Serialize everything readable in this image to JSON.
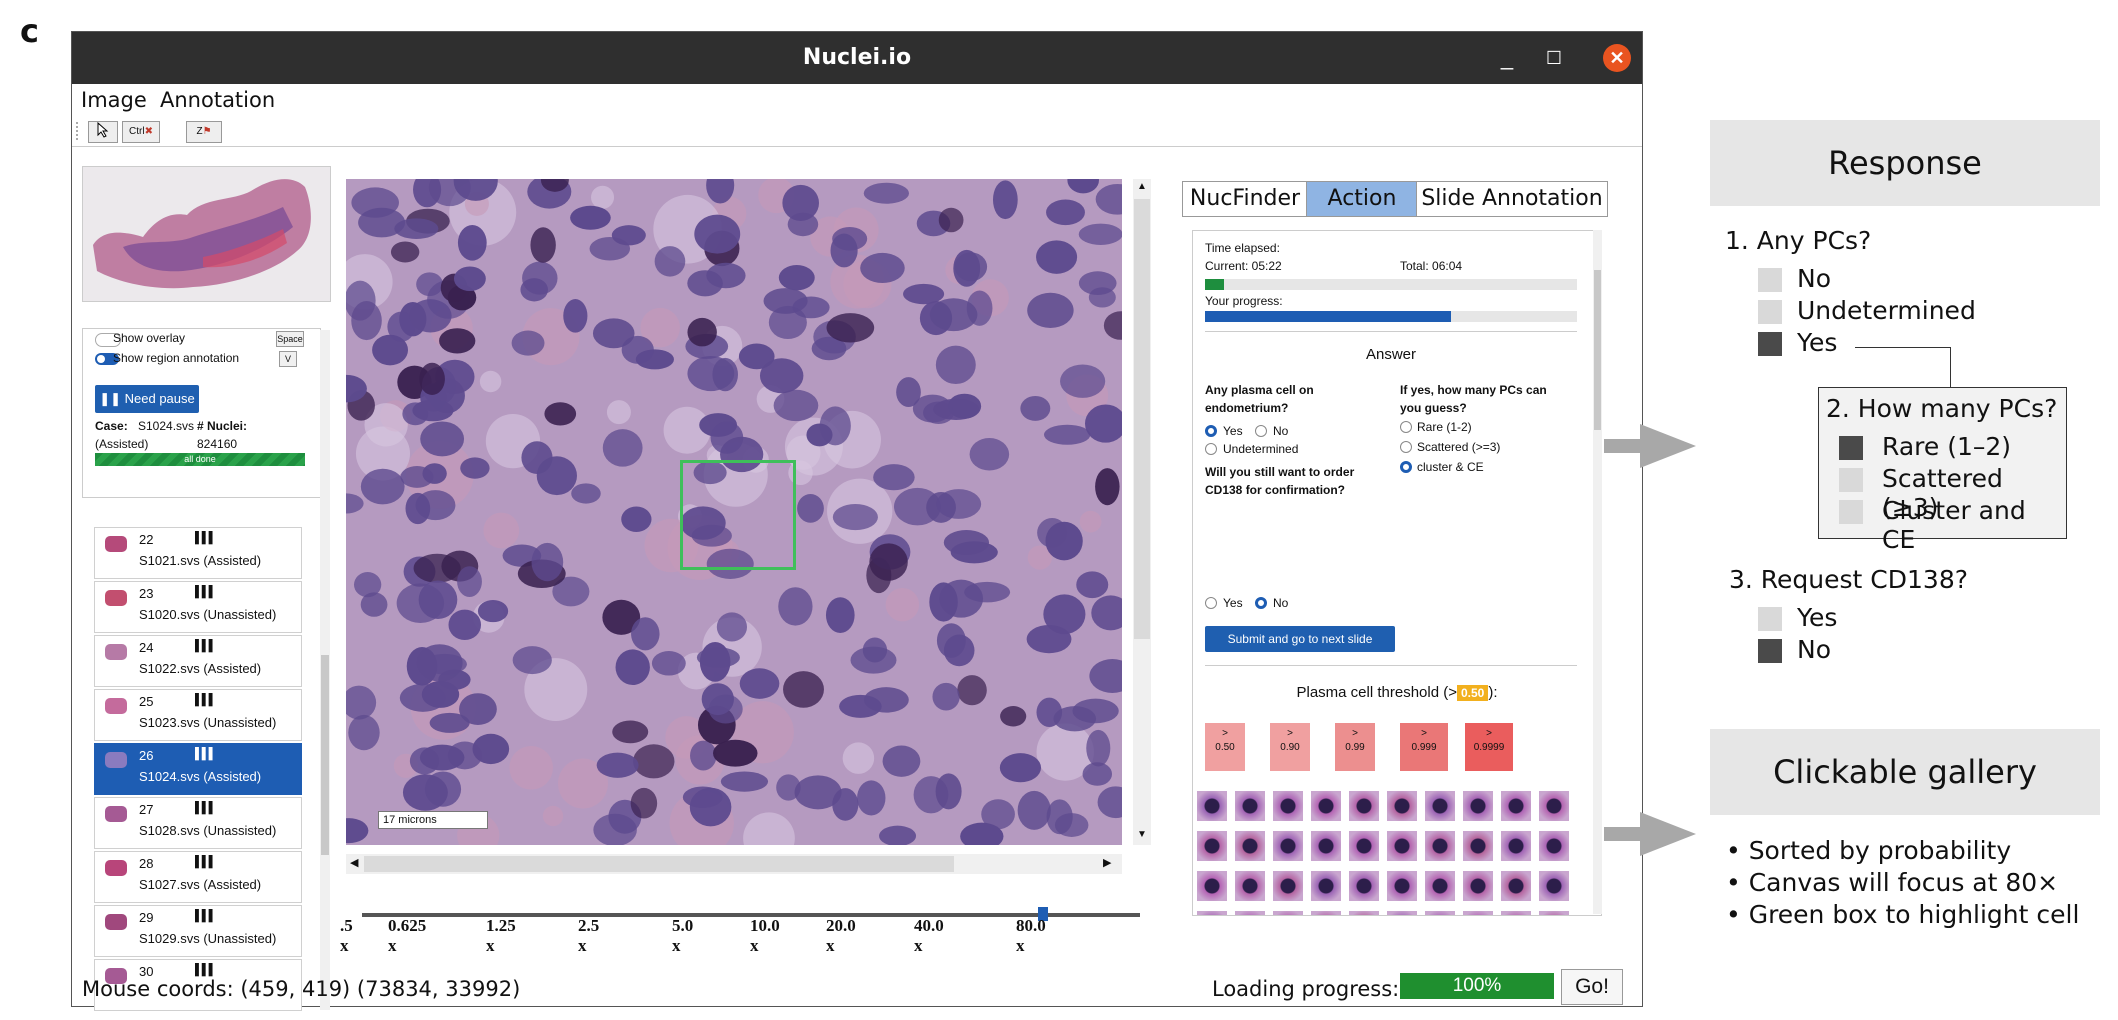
{
  "panel_letter": "c",
  "window": {
    "title": "Nuclei.io",
    "minimize": "_",
    "maximize": "☐",
    "close": "✕"
  },
  "menu": {
    "image": "Image",
    "annotation": "Annotation"
  },
  "toolbar": {
    "ctrl": "Ctrl",
    "z": "Z"
  },
  "left_panel": {
    "show_overlay": "Show overlay",
    "show_overlay_key": "Space",
    "show_region": "Show region annotation",
    "show_region_key": "V",
    "need_pause": "Need pause",
    "case_label": "Case:",
    "case_value": "S1024.svs",
    "assisted": "(Assisted)",
    "nuclei_label": "# Nuclei:",
    "nuclei_value": "824160",
    "all_done": "all done",
    "slides": [
      {
        "num": "22",
        "name": "S1021.svs (Assisted)"
      },
      {
        "num": "23",
        "name": "S1020.svs (Unassisted)"
      },
      {
        "num": "24",
        "name": "S1022.svs (Assisted)"
      },
      {
        "num": "25",
        "name": "S1023.svs (Unassisted)"
      },
      {
        "num": "26",
        "name": "S1024.svs (Assisted)"
      },
      {
        "num": "27",
        "name": "S1028.svs (Unassisted)"
      },
      {
        "num": "28",
        "name": "S1027.svs (Assisted)"
      },
      {
        "num": "29",
        "name": "S1029.svs (Unassisted)"
      },
      {
        "num": "30",
        "name": ""
      }
    ],
    "selected_slide": 4
  },
  "viewer": {
    "scale_label": "17 microns",
    "zoom_levels": [
      ".5 x",
      "0.625 x",
      "1.25 x",
      "2.5 x",
      "5.0 x",
      "10.0 x",
      "20.0 x",
      "40.0 x",
      "80.0 x"
    ],
    "zoom_selected": "80.0 x"
  },
  "tabs": [
    "NucFinder",
    "Action",
    "Slide Annotation"
  ],
  "active_tab": "Action",
  "action": {
    "time_elapsed": "Time elapsed:",
    "current": "Current: 05:22",
    "total": "Total: 06:04",
    "your_progress": "Your progress:",
    "progress": 0.66,
    "timer_fill": 0.05,
    "answer": "Answer",
    "q1": "Any plasma cell on endometrium?",
    "q1_options": [
      "Yes",
      "No",
      "Undetermined"
    ],
    "q1_selected": "Yes",
    "q2": "If yes, how many PCs can you guess?",
    "q2_options": [
      "Rare (1-2)",
      "Scattered (>=3)",
      "cluster & CE"
    ],
    "q2_selected": "cluster & CE",
    "q3": "Will you still want to order CD138 for confirmation?",
    "q3_options": [
      "Yes",
      "No"
    ],
    "q3_selected": "No",
    "submit": "Submit and go to next slide",
    "threshold_label": "Plasma cell threshold (>",
    "threshold_value": "0.50",
    "threshold_suffix": "):",
    "threshold_buttons": [
      "0.50",
      "0.90",
      "0.99",
      "0.999",
      "0.9999"
    ],
    "threshold_symbol": ">",
    "colors": {
      "button_blue": "#1f5fb0",
      "threshold_badge": "#f2b01e",
      "threshold_btn": "#ec6b6b"
    }
  },
  "status": {
    "mouse": "Mouse coords: (459, 419) (73834, 33992)",
    "loading_label": "Loading progress:",
    "loading_value": "100%",
    "go": "Go!"
  },
  "annotations": {
    "response_title": "Response",
    "q1": "1. Any PCs?",
    "q1_options": [
      "No",
      "Undetermined",
      "Yes"
    ],
    "q2": "2. How many PCs?",
    "q2_options": [
      "Rare (1–2)",
      "Scattered (≥3)",
      "Cluster and CE"
    ],
    "q3": "3. Request CD138?",
    "q3_options": [
      "Yes",
      "No"
    ],
    "gallery_title": "Clickable gallery",
    "gallery_bullets": [
      "• Sorted by probability",
      "• Canvas will focus at 80×",
      "• Green box to highlight cell"
    ]
  }
}
